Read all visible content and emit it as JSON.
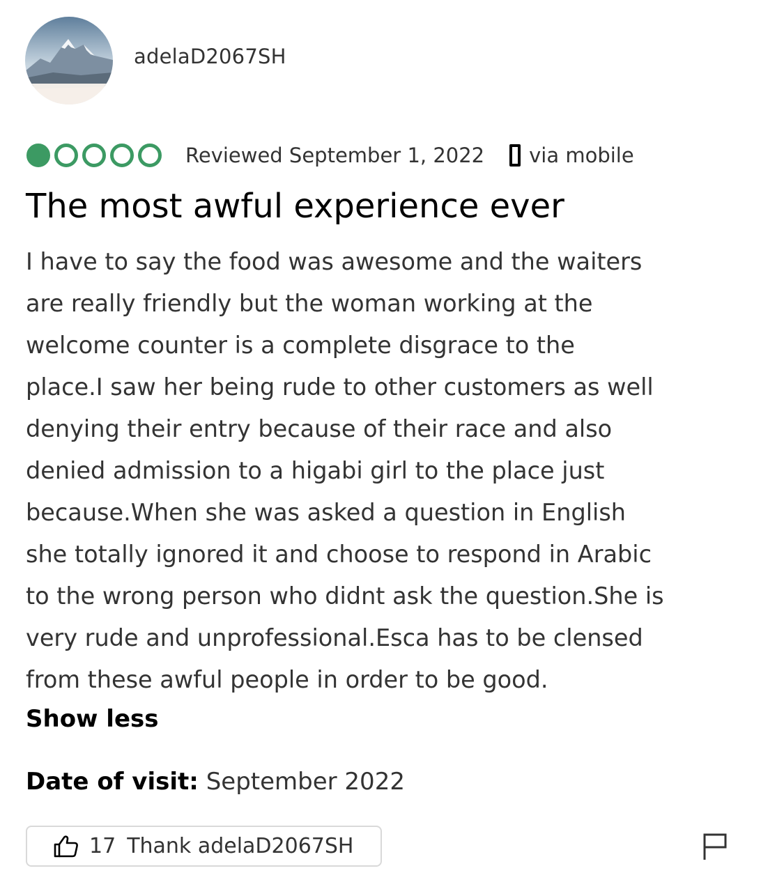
{
  "reviewer": {
    "username": "adelaD2067SH",
    "avatar_icon": "avatar-mountain-landscape-icon"
  },
  "rating": {
    "value": 1,
    "max": 5,
    "color": "#3c9a63"
  },
  "meta": {
    "reviewed_date": "Reviewed September 1, 2022",
    "via": "via mobile",
    "via_icon": "mobile-phone-icon"
  },
  "review": {
    "title": "The most awful experience ever",
    "body_lines": [
      "I have to say the food was awesome and the waiters",
      "are really friendly but the woman working at the",
      "welcome counter is a complete disgrace to the",
      "place.I saw her being rude to other customers as well",
      "denying their entry because of their race and also",
      "denied admission to a higabi girl to the place just",
      "because.When she was asked a question in English",
      "she totally ignored it and choose to respond in Arabic",
      "to the wrong person who didnt ask the question.She is",
      "very rude and unprofessional.Esca has to be clensed",
      "from these awful people in order to be good."
    ],
    "show_less_label": "Show less"
  },
  "visit": {
    "label": "Date of visit:",
    "value": "September 2022"
  },
  "actions": {
    "thank_count": "17",
    "thank_label": "Thank adelaD2067SH",
    "thank_icon": "thumbs-up-icon",
    "flag_icon": "flag-icon"
  }
}
